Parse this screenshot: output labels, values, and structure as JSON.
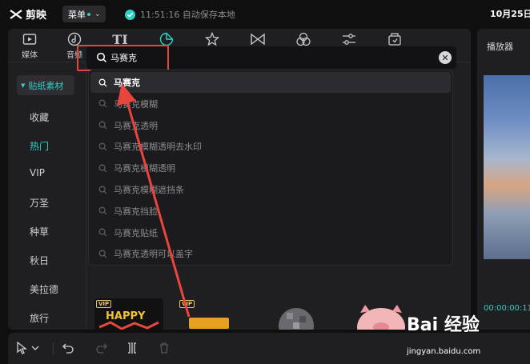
{
  "app": {
    "name": "剪映",
    "menu_label": "菜单",
    "autosave_text": "11:51:16 自动保存本地",
    "date_text": "10月25日"
  },
  "toolbar": {
    "items": [
      {
        "label": "媒体",
        "icon": "media-icon"
      },
      {
        "label": "音频",
        "icon": "audio-icon"
      },
      {
        "label": "文本",
        "icon": "text-icon"
      },
      {
        "label": "贴纸",
        "icon": "sticker-icon",
        "active": true
      },
      {
        "label": "特效",
        "icon": "effects-icon"
      },
      {
        "label": "转场",
        "icon": "transition-icon"
      },
      {
        "label": "滤镜",
        "icon": "filter-icon"
      },
      {
        "label": "调节",
        "icon": "adjust-icon"
      },
      {
        "label": "模板",
        "icon": "template-icon"
      }
    ]
  },
  "sidebar": {
    "header": "贴纸素材",
    "items": [
      {
        "label": "收藏"
      },
      {
        "label": "热门",
        "active": true
      },
      {
        "label": "VIP"
      },
      {
        "label": "万圣"
      },
      {
        "label": "种草"
      },
      {
        "label": "秋日"
      },
      {
        "label": "美拉德"
      },
      {
        "label": "旅行"
      }
    ]
  },
  "search": {
    "value": "马赛克",
    "suggestions": [
      "马赛克",
      "马赛克模糊",
      "马赛克透明",
      "马赛克模糊透明去水印",
      "马赛克模糊透明",
      "马赛克模糊遮挡条",
      "马赛克挡脸",
      "马赛克贴纸",
      "马赛克透明可以盖字"
    ]
  },
  "thumbs": {
    "vip_badge": "VIP",
    "items": [
      {
        "vip": true,
        "name": "happy-sticker"
      },
      {
        "vip": true,
        "name": "explosive-sticker"
      },
      {
        "vip": false,
        "name": "mosaic-sticker"
      },
      {
        "vip": false,
        "name": "pig-sticker"
      }
    ]
  },
  "player": {
    "title": "播放器",
    "timecode": "00:00:00:11"
  },
  "watermark": {
    "brand": "Bai 经验",
    "url": "jingyan.baidu.com"
  },
  "colors": {
    "accent": "#2fd0c4",
    "annotation": "#e8453c"
  }
}
